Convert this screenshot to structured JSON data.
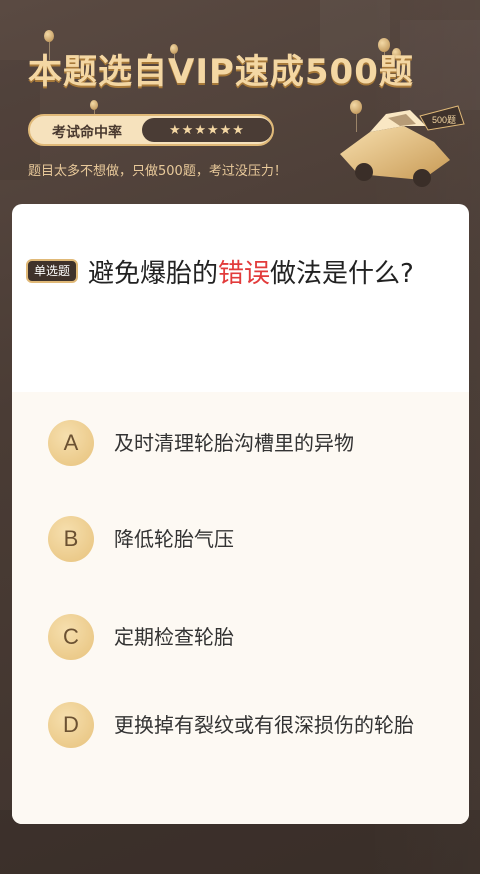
{
  "header": {
    "title": "本题选自VIP速成500题",
    "pill_label": "考试命中率",
    "stars": "★★★★★★",
    "subtitle": "题目太多不想做，只做500题，考过没压力！",
    "car_badge": "500题"
  },
  "question": {
    "tag": "单选题",
    "text_before": "避免爆胎的",
    "text_highlight": "错误",
    "text_after": "做法是什么?"
  },
  "options": [
    {
      "letter": "A",
      "text": "及时清理轮胎沟槽里的异物"
    },
    {
      "letter": "B",
      "text": "降低轮胎气压"
    },
    {
      "letter": "C",
      "text": "定期检查轮胎"
    },
    {
      "letter": "D",
      "text": "更换掉有裂纹或有很深损伤的轮胎"
    }
  ],
  "colors": {
    "accent_gold": "#f4d7a3",
    "highlight_red": "#e23b3b",
    "background_brown": "#4a3c35"
  }
}
